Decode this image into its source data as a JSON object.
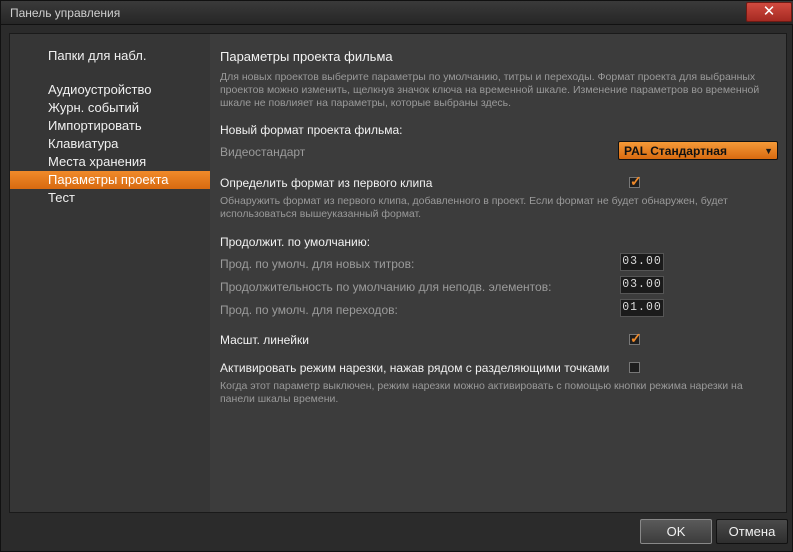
{
  "window": {
    "title": "Панель управления"
  },
  "sidebar": {
    "section_label": "Папки для набл.",
    "items": [
      {
        "label": "Аудиоустройство"
      },
      {
        "label": "Журн. событий"
      },
      {
        "label": "Импортировать"
      },
      {
        "label": "Клавиатура"
      },
      {
        "label": "Места хранения"
      },
      {
        "label": "Параметры проекта",
        "active": true
      },
      {
        "label": "Тест"
      }
    ]
  },
  "main": {
    "heading": "Параметры проекта фильма",
    "intro": "Для новых проектов выберите параметры по умолчанию, титры и переходы. Формат проекта для выбранных проектов можно изменить, щелкнув значок ключа на временной шкале. Изменение параметров во временной шкале не повлияет на параметры, которые выбраны здесь.",
    "new_format_label": "Новый формат проекта фильма:",
    "video_standard_label": "Видеостандарт",
    "video_standard_value": "PAL Стандартная",
    "detect_format_label": "Определить формат из первого клипа",
    "detect_format_checked": true,
    "detect_format_note": "Обнаружить формат из первого клипа, добавленного в проект. Если формат не будет обнаружен, будет использоваться вышеуказанный формат.",
    "durations_label": "Продолжит. по умолчанию:",
    "durations": [
      {
        "label": "Прод. по умолч. для новых титров:",
        "value": "03.00"
      },
      {
        "label": "Продолжительность по умолчанию для неподв. элементов:",
        "value": "03.00"
      },
      {
        "label": "Прод. по умолч. для переходов:",
        "value": "01.00"
      }
    ],
    "scale_rulers_label": "Масшт. линейки",
    "scale_rulers_checked": true,
    "scissors_label": "Активировать режим нарезки, нажав рядом с разделяющими точками",
    "scissors_checked": false,
    "scissors_note": "Когда этот параметр выключен, режим нарезки можно активировать с помощью кнопки режима нарезки на панели шкалы времени."
  },
  "footer": {
    "ok_label": "OK",
    "cancel_label": "Отмена"
  },
  "colors": {
    "accent": "#f08a2a",
    "panel": "#3c3c3c",
    "sidebar": "#363636",
    "close": "#c0392b"
  }
}
